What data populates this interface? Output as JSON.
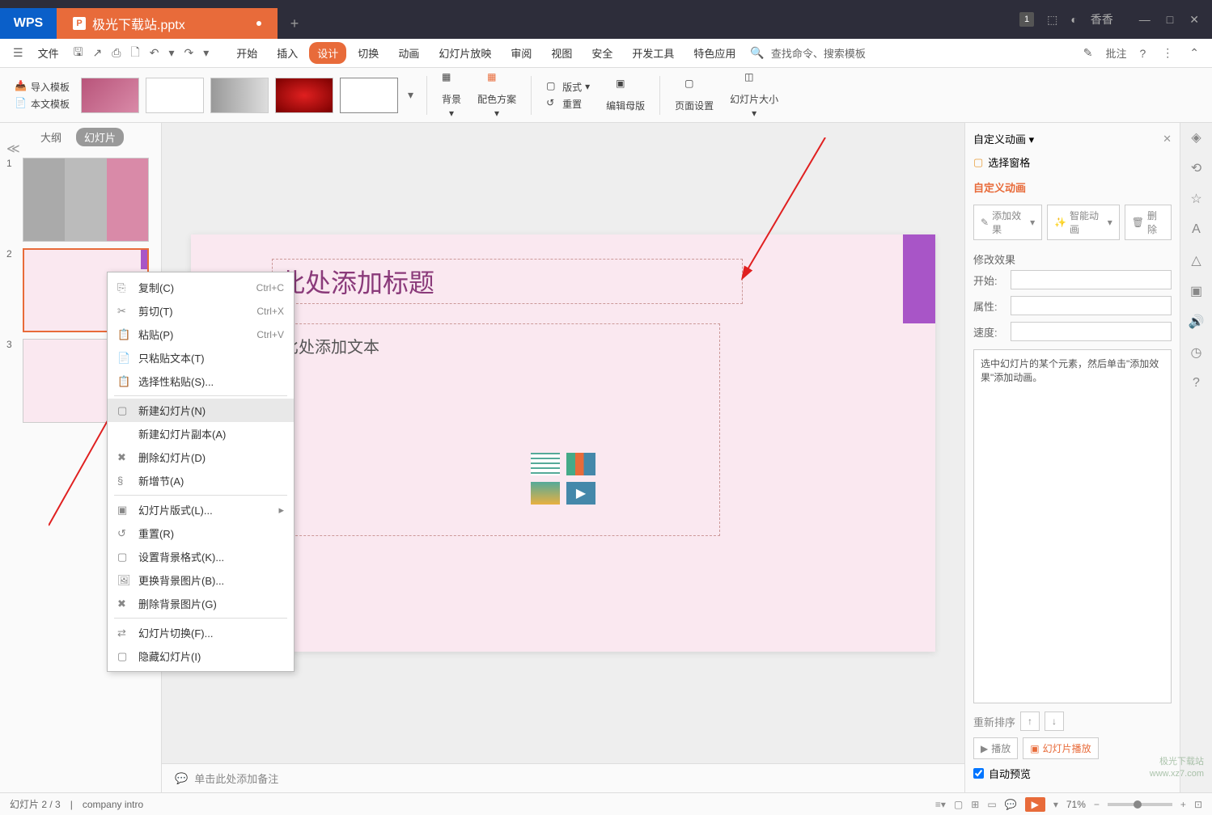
{
  "titlebar": {
    "app": "WPS",
    "tab_name": "极光下载站.pptx",
    "badge": "1",
    "user": "香香"
  },
  "menubar": {
    "file": "文件",
    "items": [
      "开始",
      "插入",
      "设计",
      "切换",
      "动画",
      "幻灯片放映",
      "审阅",
      "视图",
      "安全",
      "开发工具",
      "特色应用"
    ],
    "active_index": 2,
    "search": "查找命令、搜索模板",
    "annotate": "批注"
  },
  "ribbon": {
    "import_template": "导入模板",
    "this_template": "本文模板",
    "background": "背景",
    "color_scheme": "配色方案",
    "layout": "版式",
    "reset": "重置",
    "edit_master": "编辑母版",
    "page_setup": "页面设置",
    "slide_size": "幻灯片大小"
  },
  "left_panel": {
    "tab_outline": "大纲",
    "tab_slides": "幻灯片",
    "slide_numbers": [
      "1",
      "2",
      "3"
    ]
  },
  "canvas": {
    "title_placeholder": "此处添加标题",
    "body_placeholder": "比处添加文本"
  },
  "notes": {
    "placeholder": "单击此处添加备注"
  },
  "context_menu": {
    "items": [
      {
        "label": "复制(C)",
        "shortcut": "Ctrl+C"
      },
      {
        "label": "剪切(T)",
        "shortcut": "Ctrl+X"
      },
      {
        "label": "粘贴(P)",
        "shortcut": "Ctrl+V"
      },
      {
        "label": "只粘贴文本(T)",
        "shortcut": ""
      },
      {
        "label": "选择性粘贴(S)...",
        "shortcut": ""
      },
      {
        "sep": true
      },
      {
        "label": "新建幻灯片(N)",
        "shortcut": "",
        "highlight": true
      },
      {
        "label": "新建幻灯片副本(A)",
        "shortcut": ""
      },
      {
        "label": "删除幻灯片(D)",
        "shortcut": ""
      },
      {
        "label": "新增节(A)",
        "shortcut": ""
      },
      {
        "sep": true
      },
      {
        "label": "幻灯片版式(L)...",
        "shortcut": "",
        "submenu": true
      },
      {
        "label": "重置(R)",
        "shortcut": ""
      },
      {
        "label": "设置背景格式(K)...",
        "shortcut": ""
      },
      {
        "label": "更换背景图片(B)...",
        "shortcut": ""
      },
      {
        "label": "删除背景图片(G)",
        "shortcut": ""
      },
      {
        "sep": true
      },
      {
        "label": "幻灯片切换(F)...",
        "shortcut": ""
      },
      {
        "label": "隐藏幻灯片(I)",
        "shortcut": ""
      }
    ]
  },
  "right_panel": {
    "title": "自定义动画",
    "select_pane": "选择窗格",
    "section": "自定义动画",
    "add_effect": "添加效果",
    "smart_anim": "智能动画",
    "delete": "删除",
    "modify": "修改效果",
    "start_label": "开始:",
    "prop_label": "属性:",
    "speed_label": "速度:",
    "hint": "选中幻灯片的某个元素，然后单击\"添加效果\"添加动画。",
    "reorder": "重新排序",
    "play": "播放",
    "slideshow": "幻灯片播放",
    "auto_preview": "自动预览"
  },
  "statusbar": {
    "slide_info": "幻灯片 2 / 3",
    "template": "company intro",
    "zoom": "71%"
  },
  "watermark": {
    "l1": "极光下载站",
    "l2": "www.xz7.com"
  }
}
